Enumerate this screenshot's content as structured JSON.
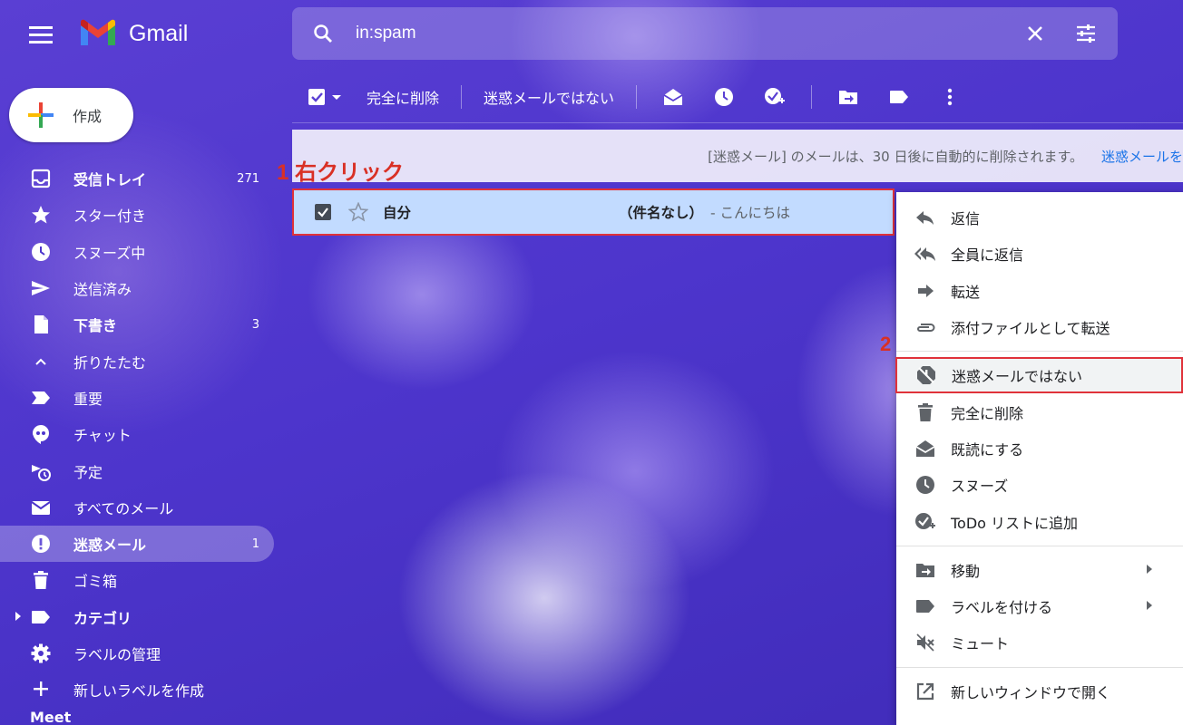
{
  "header": {
    "app_name": "Gmail",
    "search_value": "in:spam"
  },
  "compose": {
    "label": "作成"
  },
  "sidebar": {
    "items": [
      {
        "label": "受信トレイ",
        "count": "271",
        "icon": "inbox-icon"
      },
      {
        "label": "スター付き",
        "count": "",
        "icon": "star-icon"
      },
      {
        "label": "スヌーズ中",
        "count": "",
        "icon": "clock-icon"
      },
      {
        "label": "送信済み",
        "count": "",
        "icon": "send-icon"
      },
      {
        "label": "下書き",
        "count": "3",
        "icon": "draft-icon"
      },
      {
        "label": "折りたたむ",
        "count": "",
        "icon": "chevron-up-icon"
      },
      {
        "label": "重要",
        "count": "",
        "icon": "important-icon"
      },
      {
        "label": "チャット",
        "count": "",
        "icon": "chat-icon"
      },
      {
        "label": "予定",
        "count": "",
        "icon": "scheduled-icon"
      },
      {
        "label": "すべてのメール",
        "count": "",
        "icon": "mail-icon"
      },
      {
        "label": "迷惑メール",
        "count": "1",
        "icon": "spam-icon"
      },
      {
        "label": "ゴミ箱",
        "count": "",
        "icon": "trash-icon"
      },
      {
        "label": "カテゴリ",
        "count": "",
        "icon": "label-icon"
      },
      {
        "label": "ラベルの管理",
        "count": "",
        "icon": "gear-icon"
      },
      {
        "label": "新しいラベルを作成",
        "count": "",
        "icon": "plus-icon"
      }
    ],
    "meet_label": "Meet"
  },
  "toolbar": {
    "delete_forever": "完全に削除",
    "not_spam": "迷惑メールではない"
  },
  "banner": {
    "text": "[迷惑メール] のメールは、30 日後に自動的に削除されます。",
    "link": "迷惑メールを"
  },
  "annotations": {
    "step1": "1 右クリック",
    "step2": "2"
  },
  "email": {
    "sender": "自分",
    "subject": "（件名なし）",
    "snippet": "- こんにちは"
  },
  "context_menu": {
    "reply": "返信",
    "reply_all": "全員に返信",
    "forward": "転送",
    "forward_attachment": "添付ファイルとして転送",
    "not_spam": "迷惑メールではない",
    "delete_forever": "完全に削除",
    "mark_read": "既読にする",
    "snooze": "スヌーズ",
    "add_todo": "ToDo リストに追加",
    "move": "移動",
    "label": "ラベルを付ける",
    "mute": "ミュート",
    "open_new_window": "新しいウィンドウで開く"
  },
  "colors": {
    "accent": "#1a73e8",
    "selected_row": "#c2dbff",
    "annotation": "#d93025"
  }
}
